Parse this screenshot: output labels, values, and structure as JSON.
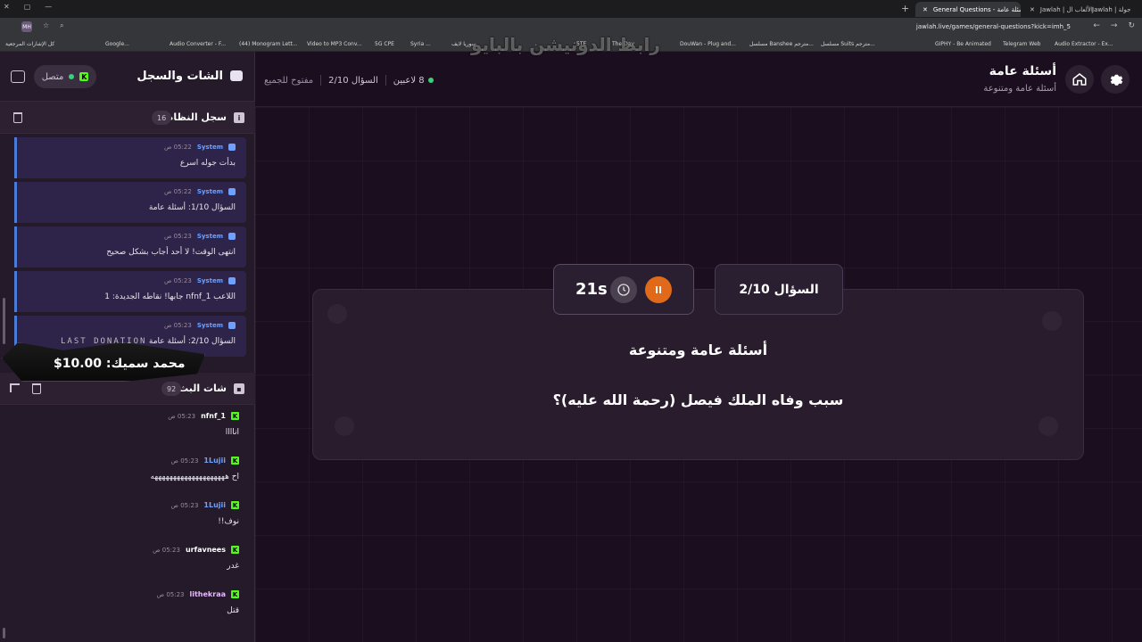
{
  "browser": {
    "tabs": [
      {
        "label": "General Questions - أسئلة عامة",
        "active": true
      },
      {
        "label": "Jawlah | منصة الألعاب ال...",
        "active": false
      },
      {
        "label": "Jawlah | جولة",
        "active": false
      }
    ],
    "url": "jawlah.live/games/general-questions?kick=imh_5",
    "profile_initials": "MH",
    "bookmarks": [
      "كل الإشارات المرجعية",
      "Google...",
      "Audio Converter - F...",
      "(44) Monogram Lett...",
      "Video to MP3 Conv...",
      "5G CPE",
      "Syria ...",
      "سوريا لايف",
      "5TE",
      "The Day",
      "DouWan - Plug and...",
      "مسلسل Banshee مترجم...",
      "مسلسل Suits مترجم...",
      "GIPHY - Be Animated",
      "Telegram Web",
      "Audio Extractor - Ex..."
    ]
  },
  "watermark": "رابط الدونيشن بالبايو",
  "header": {
    "title": "أسئلة عامة",
    "subtitle": "أسئلة عامة ومتنوعة",
    "players": "8 لاعبين",
    "question_progress": "السؤال 2/10",
    "mode": "مفتوح للجميع"
  },
  "question": {
    "badge": "السؤال 2/10",
    "timer": "21s",
    "category": "أسئلة عامة ومتنوعة",
    "text": "سبب وفاه الملك فيصل (رحمة الله عليه)؟"
  },
  "sidebar": {
    "title": "الشات والسجل",
    "connection": "متصل",
    "system_log": {
      "title": "سجل النظام",
      "count": "16",
      "items": [
        {
          "user": "System",
          "time": "05:22 ص",
          "msg": "بدأت جوله اسرع"
        },
        {
          "user": "System",
          "time": "05:22 ص",
          "msg": "السؤال 1/10: أسئلة عامة"
        },
        {
          "user": "System",
          "time": "05:23 ص",
          "msg": "انتهى الوقت! لا أحد أجاب بشكل صحيح"
        },
        {
          "user": "System",
          "time": "05:23 ص",
          "msg": "اللاعب nfnf_1 جابها! نقاطه الجديدة: 1"
        },
        {
          "user": "System",
          "time": "05:23 ص",
          "msg": "السؤال 2/10: أسئلة عامة"
        }
      ]
    },
    "live_chat": {
      "title": "شات البث",
      "count": "92",
      "items": [
        {
          "user": "nfnf_1",
          "time": "05:23 ص",
          "msg": "اناااا",
          "color": "#ffffff"
        },
        {
          "user": "1Lujii",
          "time": "05:23 ص",
          "msg": "اح ههههههههههههههههههههه",
          "color": "#6fa0ff"
        },
        {
          "user": "1Lujii",
          "time": "05:23 ص",
          "msg": "نوف!!",
          "color": "#6fa0ff"
        },
        {
          "user": "urfavnees",
          "time": "05:23 ص",
          "msg": "غدر",
          "color": "#ffffff"
        },
        {
          "user": "lithekraa",
          "time": "05:23 ص",
          "msg": "قتل",
          "color": "#e8b9ff"
        }
      ]
    }
  },
  "donation": {
    "label": "LAST DONATION",
    "amount": "محمد سميك: 10.00$"
  }
}
